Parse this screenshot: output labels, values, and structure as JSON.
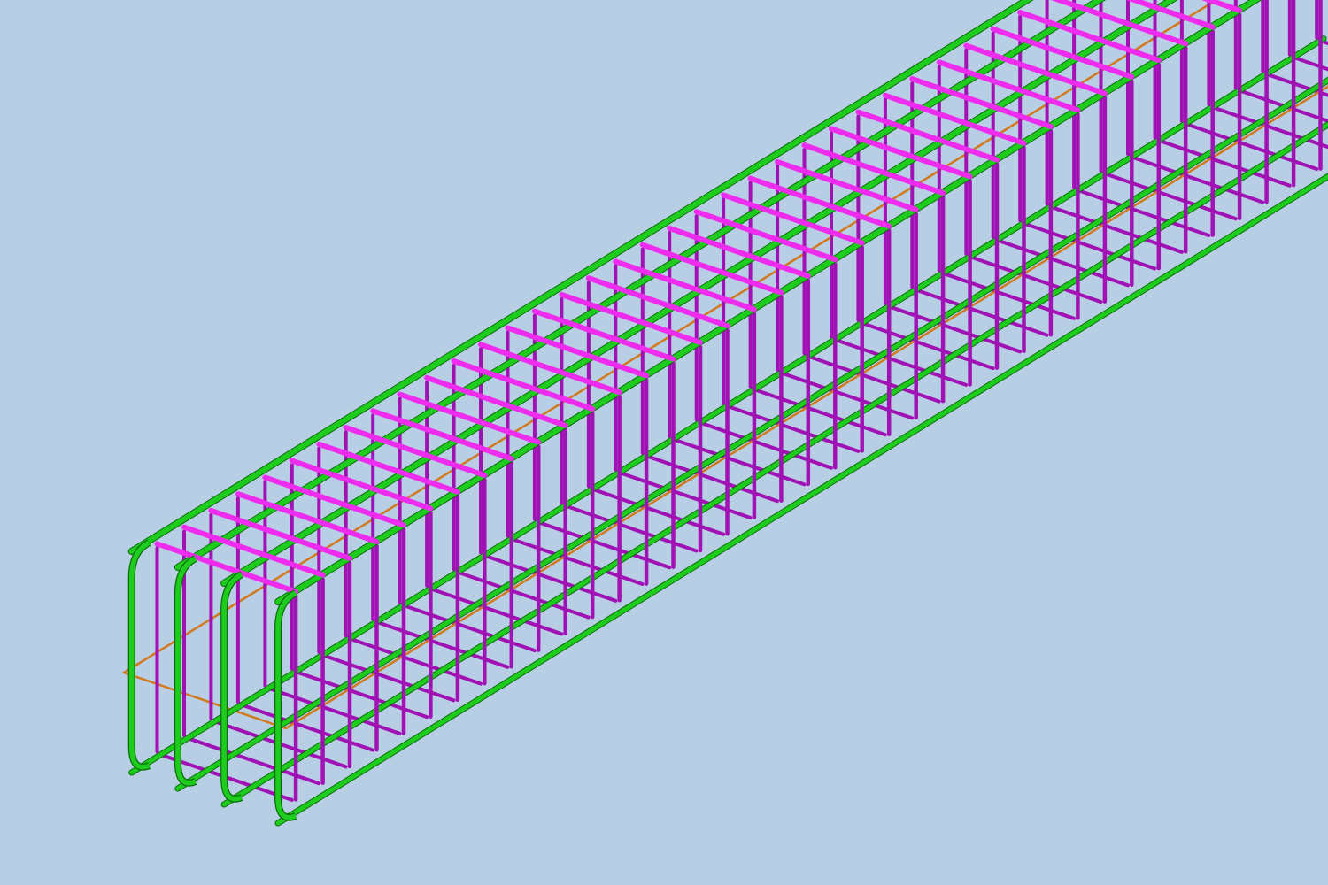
{
  "viewport": {
    "background_color": "#b8cee4",
    "projection": "isometric"
  },
  "model": {
    "element": "reinforced-concrete-beam-cage",
    "longitudinal_bar_color": "#1ecc1e",
    "longitudinal_bar_outline": "#0a6e0a",
    "stirrup_color": "#a012b4",
    "stirrup_top_color": "#ee2cee",
    "guide_line_color": "#d2781e",
    "stirrup_count": 44
  }
}
